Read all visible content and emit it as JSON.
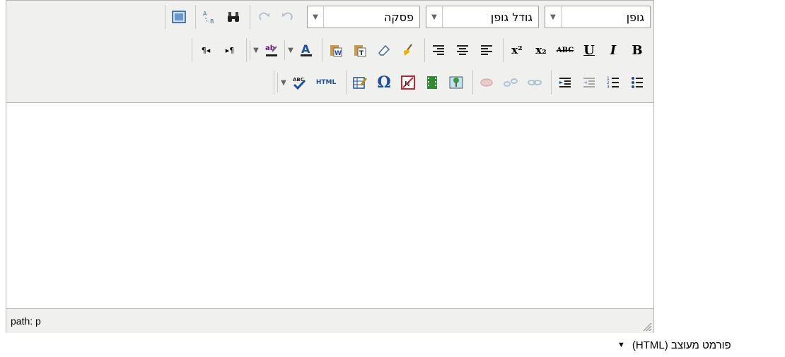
{
  "toolbar": {
    "font_family": {
      "label": "גופן"
    },
    "font_size": {
      "label": "גודל גופן"
    },
    "format_block": {
      "label": "פסקה"
    },
    "superscript_text": "x²",
    "subscript_text": "x₂",
    "strike_text": "ABC",
    "underline_text": "U",
    "italic_text": "I",
    "bold_text": "B",
    "html_text": "HTML",
    "abc_text": "ABC",
    "ab_text": "ab",
    "omega_text": "Ω",
    "ltr_text": "¶◂",
    "rtl_text": "▸¶"
  },
  "statusbar": {
    "path": "path: p"
  },
  "format_selector": {
    "value": "פורמט מעוצב (HTML)"
  },
  "colors": {
    "toolbar_bg": "#f0f0ee",
    "border": "#b5b5b5"
  }
}
